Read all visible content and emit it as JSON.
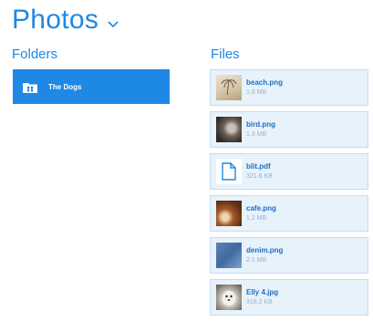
{
  "header": {
    "title": "Photos",
    "chevron_icon": "chevron-down-icon",
    "color": "#1e88e5"
  },
  "folders": {
    "title": "Folders",
    "items": [
      {
        "label": "The Dogs",
        "icon": "folder-shared-icon",
        "color": "#1e88e5"
      }
    ]
  },
  "files": {
    "title": "Files",
    "items": [
      {
        "name": "beach.png",
        "size": "1.6 MB",
        "thumb": "beach"
      },
      {
        "name": "bird.png",
        "size": "1.3 MB",
        "thumb": "bird"
      },
      {
        "name": "blit.pdf",
        "size": "321.6 KB",
        "thumb": "pdf"
      },
      {
        "name": "cafe.png",
        "size": "1.2 MB",
        "thumb": "cafe"
      },
      {
        "name": "denim.png",
        "size": "2.1 MB",
        "thumb": "denim"
      },
      {
        "name": "Elly 4.jpg",
        "size": "318.2 KB",
        "thumb": "elly"
      }
    ]
  }
}
